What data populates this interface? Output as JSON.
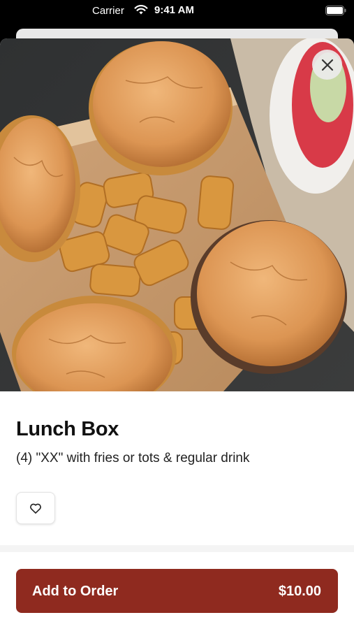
{
  "status_bar": {
    "carrier": "Carrier",
    "time": "9:41 AM"
  },
  "item": {
    "title": "Lunch Box",
    "description": "(4) \"XX\" with fries or tots & regular drink",
    "image_alt": "Four sliders with tater tots in a cardboard box and a drink"
  },
  "actions": {
    "add_label": "Add to Order",
    "price": "$10.00"
  },
  "icons": {
    "close": "close-icon",
    "favorite": "heart-icon",
    "wifi": "wifi-icon",
    "battery": "battery-icon"
  },
  "colors": {
    "primary": "#8f2a1f",
    "text": "#111111"
  }
}
